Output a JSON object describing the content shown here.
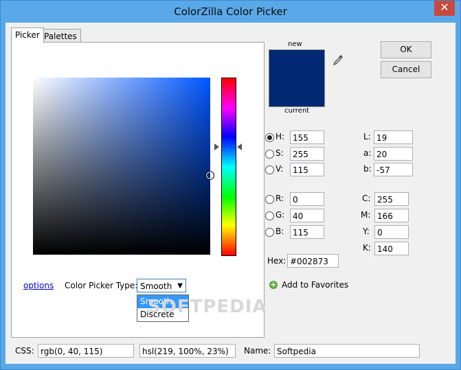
{
  "window": {
    "title": "ColorZilla Color Picker",
    "close_glyph": "✕"
  },
  "tabs": [
    {
      "label": "Picker"
    },
    {
      "label": "Palettes"
    }
  ],
  "picker": {
    "options_link": "options",
    "type_label": "Color Picker Type:",
    "type_selected": "Smooth",
    "type_options": [
      "Smooth",
      "Discrete"
    ]
  },
  "preview": {
    "new_label": "new",
    "current_label": "current",
    "color": "#002873"
  },
  "buttons": {
    "ok": "OK",
    "cancel": "Cancel"
  },
  "hsv": {
    "h": {
      "label": "H:",
      "value": "155"
    },
    "s": {
      "label": "S:",
      "value": "255"
    },
    "v": {
      "label": "V:",
      "value": "115"
    }
  },
  "rgb": {
    "r": {
      "label": "R:",
      "value": "0"
    },
    "g": {
      "label": "G:",
      "value": "40"
    },
    "b": {
      "label": "B:",
      "value": "115"
    }
  },
  "lab": {
    "l": {
      "label": "L:",
      "value": "19"
    },
    "a": {
      "label": "a:",
      "value": "20"
    },
    "b": {
      "label": "b:",
      "value": "-57"
    }
  },
  "cmyk": {
    "c": {
      "label": "C:",
      "value": "255"
    },
    "m": {
      "label": "M:",
      "value": "166"
    },
    "y": {
      "label": "Y:",
      "value": "0"
    },
    "k": {
      "label": "K:",
      "value": "140"
    }
  },
  "hex": {
    "label": "Hex:",
    "value": "#002873"
  },
  "favorites": {
    "label": "Add to Favorites"
  },
  "css": {
    "label": "CSS:",
    "rgb": "rgb(0, 40, 115)",
    "hsl": "hsl(219, 100%, 23%)"
  },
  "name": {
    "label": "Name:",
    "value": "Softpedia"
  },
  "watermark": "SOFTPEDIA",
  "colors": {
    "title_bar": "#5aa8e8",
    "close_button": "#c9483e",
    "selection": "#3399ff"
  }
}
